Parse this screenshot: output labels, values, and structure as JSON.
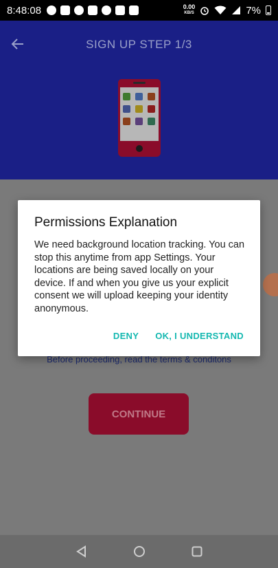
{
  "status_bar": {
    "time": "8:48:08",
    "net_speed": "0.00",
    "net_unit": "KB/S",
    "battery": "7%"
  },
  "header": {
    "back_icon": "arrow-left-icon",
    "title": "SIGN UP STEP 1/3",
    "illustration": "phone-apps-illustration"
  },
  "main": {
    "terms_text": "Before proceeding, read the terms & conditons",
    "continue_label": "CONTINUE"
  },
  "dialog": {
    "title": "Permissions Explanation",
    "body": "We need background location tracking. You can stop this anytime from app Settings. Your locations are being saved locally on your device. If and when you give us your explicit consent we will upload keeping your identity anonymous.",
    "deny_label": "DENY",
    "accept_label": "OK, I UNDERSTAND"
  },
  "colors": {
    "header_bg": "#1a1f86",
    "accent": "#14b8b0",
    "primary_button": "#8a0c2a"
  }
}
